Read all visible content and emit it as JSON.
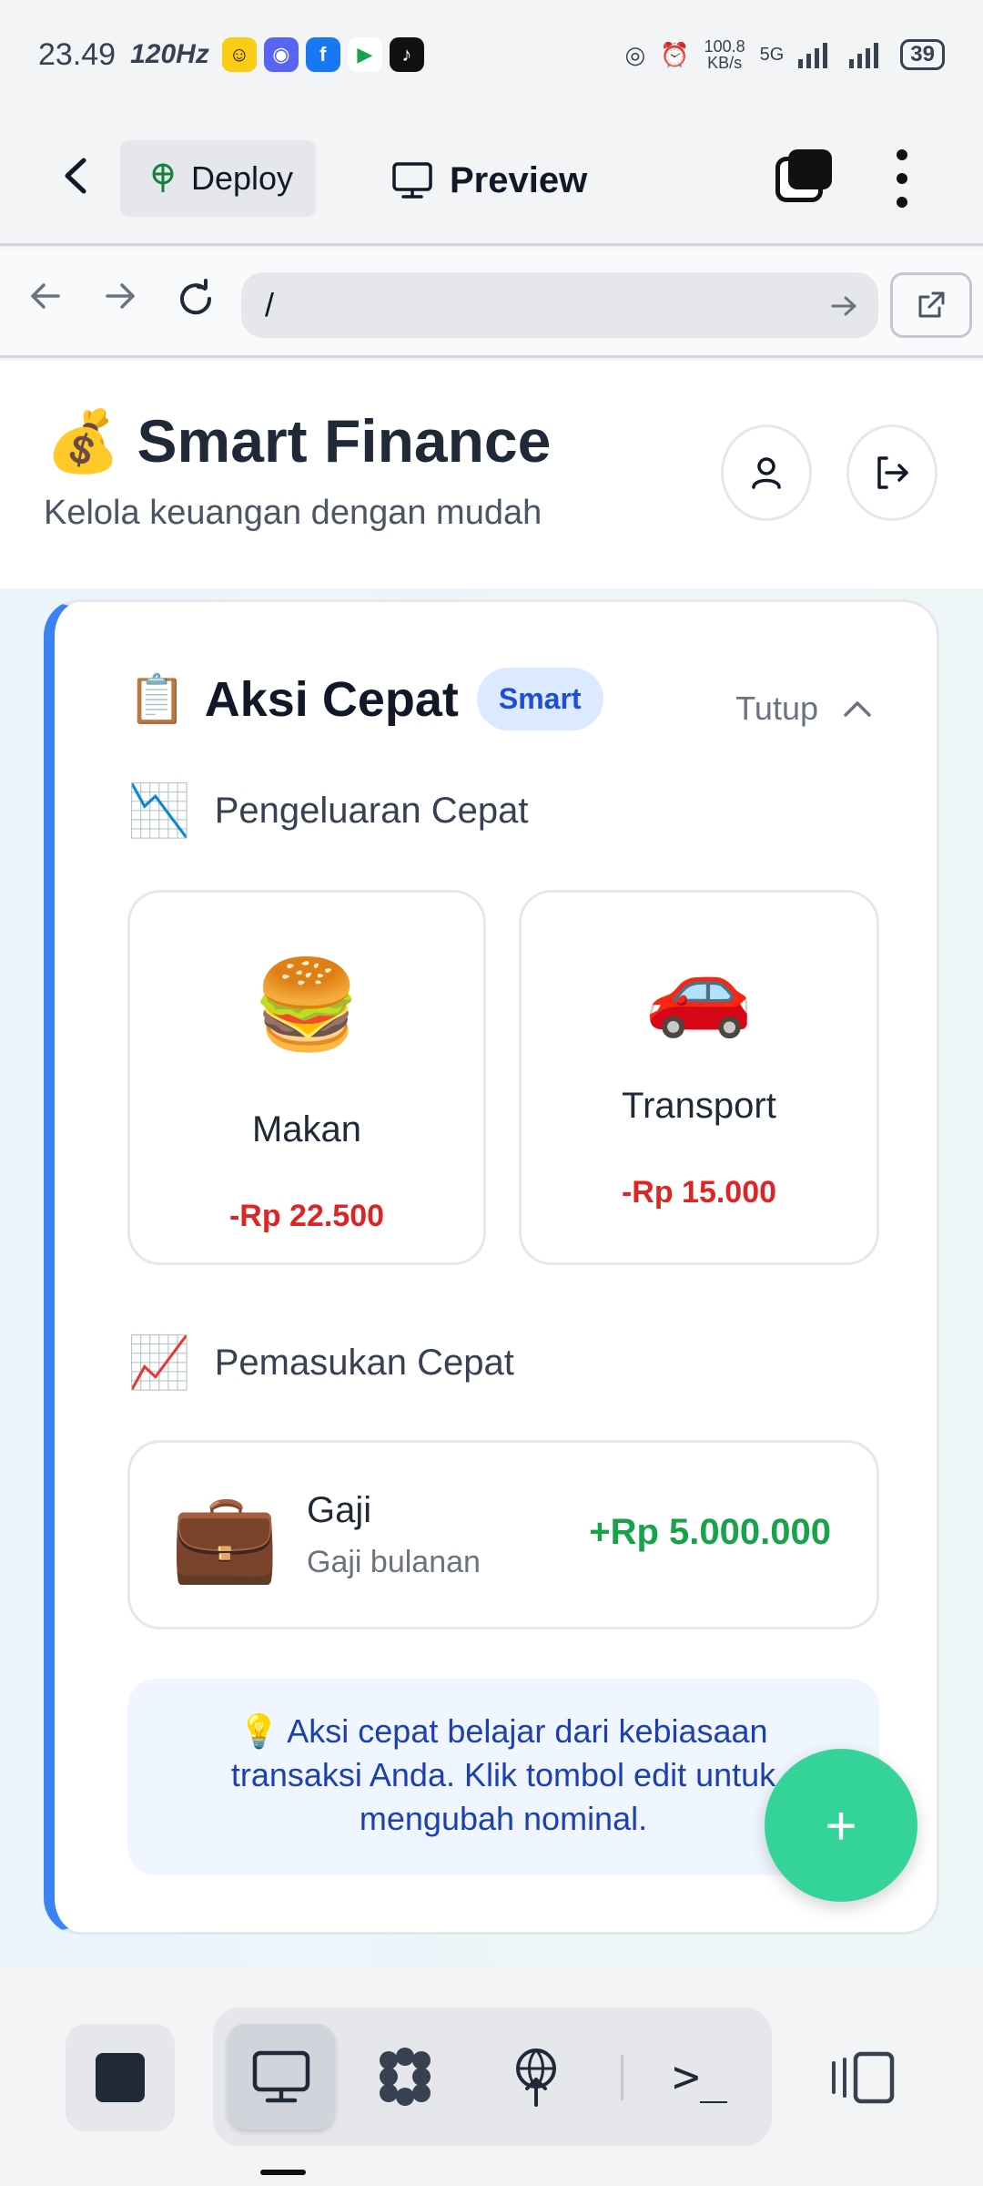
{
  "status_bar": {
    "time": "23.49",
    "refresh": "120Hz",
    "speed_value": "100.8",
    "speed_unit": "KB/s",
    "network": "5G",
    "battery": "39"
  },
  "app_bar": {
    "back_icon": "chevron-left-icon",
    "deploy_label": "Deploy",
    "preview_label": "Preview"
  },
  "url_bar": {
    "url": "/"
  },
  "header": {
    "title_emoji": "💰",
    "title": "Smart Finance",
    "subtitle": "Kelola keuangan dengan mudah"
  },
  "quick_actions": {
    "icon": "📋",
    "title": "Aksi Cepat",
    "badge": "Smart",
    "collapse_label": "Tutup",
    "expense_icon": "📉",
    "expense_heading": "Pengeluaran Cepat",
    "expenses": [
      {
        "emoji": "🍔",
        "name": "Makan",
        "amount": "-Rp 22.500"
      },
      {
        "emoji": "🚗",
        "name": "Transport",
        "amount": "-Rp 15.000"
      }
    ],
    "income_icon": "📈",
    "income_heading": "Pemasukan Cepat",
    "incomes": [
      {
        "emoji": "💼",
        "name": "Gaji",
        "description": "Gaji bulanan",
        "amount": "+Rp 5.000.000"
      }
    ],
    "tip_icon": "💡",
    "tip": "Aksi cepat belajar dari kebiasaan transaksi Anda. Klik tombol edit untuk mengubah nominal."
  },
  "fab": {
    "label": "+"
  },
  "toolbar": {
    "terminal_label": ">_"
  },
  "colors": {
    "accent_blue": "#3b82f6",
    "expense_red": "#dc2626",
    "income_green": "#16a34a",
    "fab_green": "#34d399"
  }
}
